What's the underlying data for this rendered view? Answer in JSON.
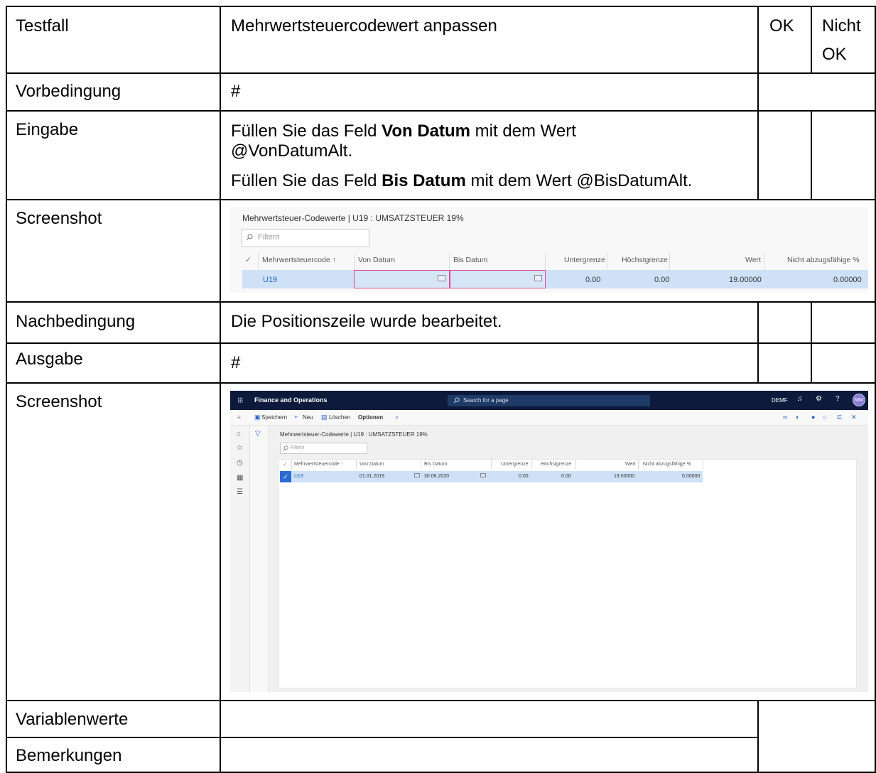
{
  "table": {
    "rows": {
      "testfall": {
        "label": "Testfall",
        "text": "Mehrwertsteuercodewert anpassen",
        "ok_label": "OK",
        "nicht_label_1": "Nicht",
        "nicht_label_2": "OK"
      },
      "vorbedingung": {
        "label": "Vorbedingung",
        "text": "#"
      },
      "eingabe": {
        "label": "Eingabe",
        "line1_pre": "Füllen Sie das Feld ",
        "line1_bold": "Von Datum",
        "line1_post": " mit dem Wert",
        "line1_cont": "@VonDatumAlt.",
        "line2_pre": "Füllen Sie das Feld ",
        "line2_bold": "Bis Datum",
        "line2_post": " mit dem Wert @BisDatumAlt."
      },
      "screenshot1": {
        "label": "Screenshot"
      },
      "nachbedingung": {
        "label": "Nachbedingung",
        "text": "Die Positionszeile wurde bearbeitet."
      },
      "ausgabe": {
        "label": "Ausgabe",
        "text": "#"
      },
      "screenshot2": {
        "label": "Screenshot"
      },
      "variablenwerte": {
        "label": "Variablenwerte",
        "text": ""
      },
      "bemerkungen": {
        "label": "Bemerkungen",
        "text": ""
      }
    }
  },
  "shot1": {
    "title": "Mehrwertsteuer-Codewerte  |  U19 : UMSATZSTEUER 19%",
    "filter_placeholder": "Filtern",
    "columns": [
      "Mehrwertsteuercode ↑",
      "Von Datum",
      "Bis Datum",
      "Untergrenze",
      "Höchstgrenze",
      "Wert",
      "Nicht abzugsfähige %"
    ],
    "row": {
      "code": "U19",
      "von": "",
      "bis": "",
      "untergrenze": "0.00",
      "hoechstgrenze": "0.00",
      "wert": "19.00000",
      "nicht": "0.00000"
    }
  },
  "shot2": {
    "app_name": "Finance and Operations",
    "search_placeholder": "Search for a page",
    "company": "DEMF",
    "avatar": "MM",
    "actions": {
      "save": "Speichern",
      "new": "Neu",
      "delete": "Löschen",
      "options": "Optionen"
    },
    "title": "Mehrwertsteuer-Codewerte  |  U19 : UMSATZSTEUER 19%",
    "filter_placeholder": "Filtern",
    "columns": [
      "Mehrwertsteuercode ↑",
      "Von Datum",
      "Bis Datum",
      "Untergrenze",
      "Höchstgrenze",
      "Wert",
      "Nicht abzugsfähige %"
    ],
    "row": {
      "code": "U19",
      "von": "01.01.2019",
      "bis": "30.06.2020",
      "untergrenze": "0.00",
      "hoechstgrenze": "0.00",
      "wert": "19.00000",
      "nicht": "0.00000"
    }
  },
  "icons": [
    "search-icon",
    "calendar-icon",
    "waffle-icon",
    "bell-icon",
    "gear-icon",
    "help-icon",
    "save-icon",
    "plus-icon",
    "delete-icon",
    "home-icon",
    "star-icon",
    "clock-icon",
    "workspace-icon",
    "list-icon",
    "filter-icon",
    "checkmark-icon"
  ]
}
